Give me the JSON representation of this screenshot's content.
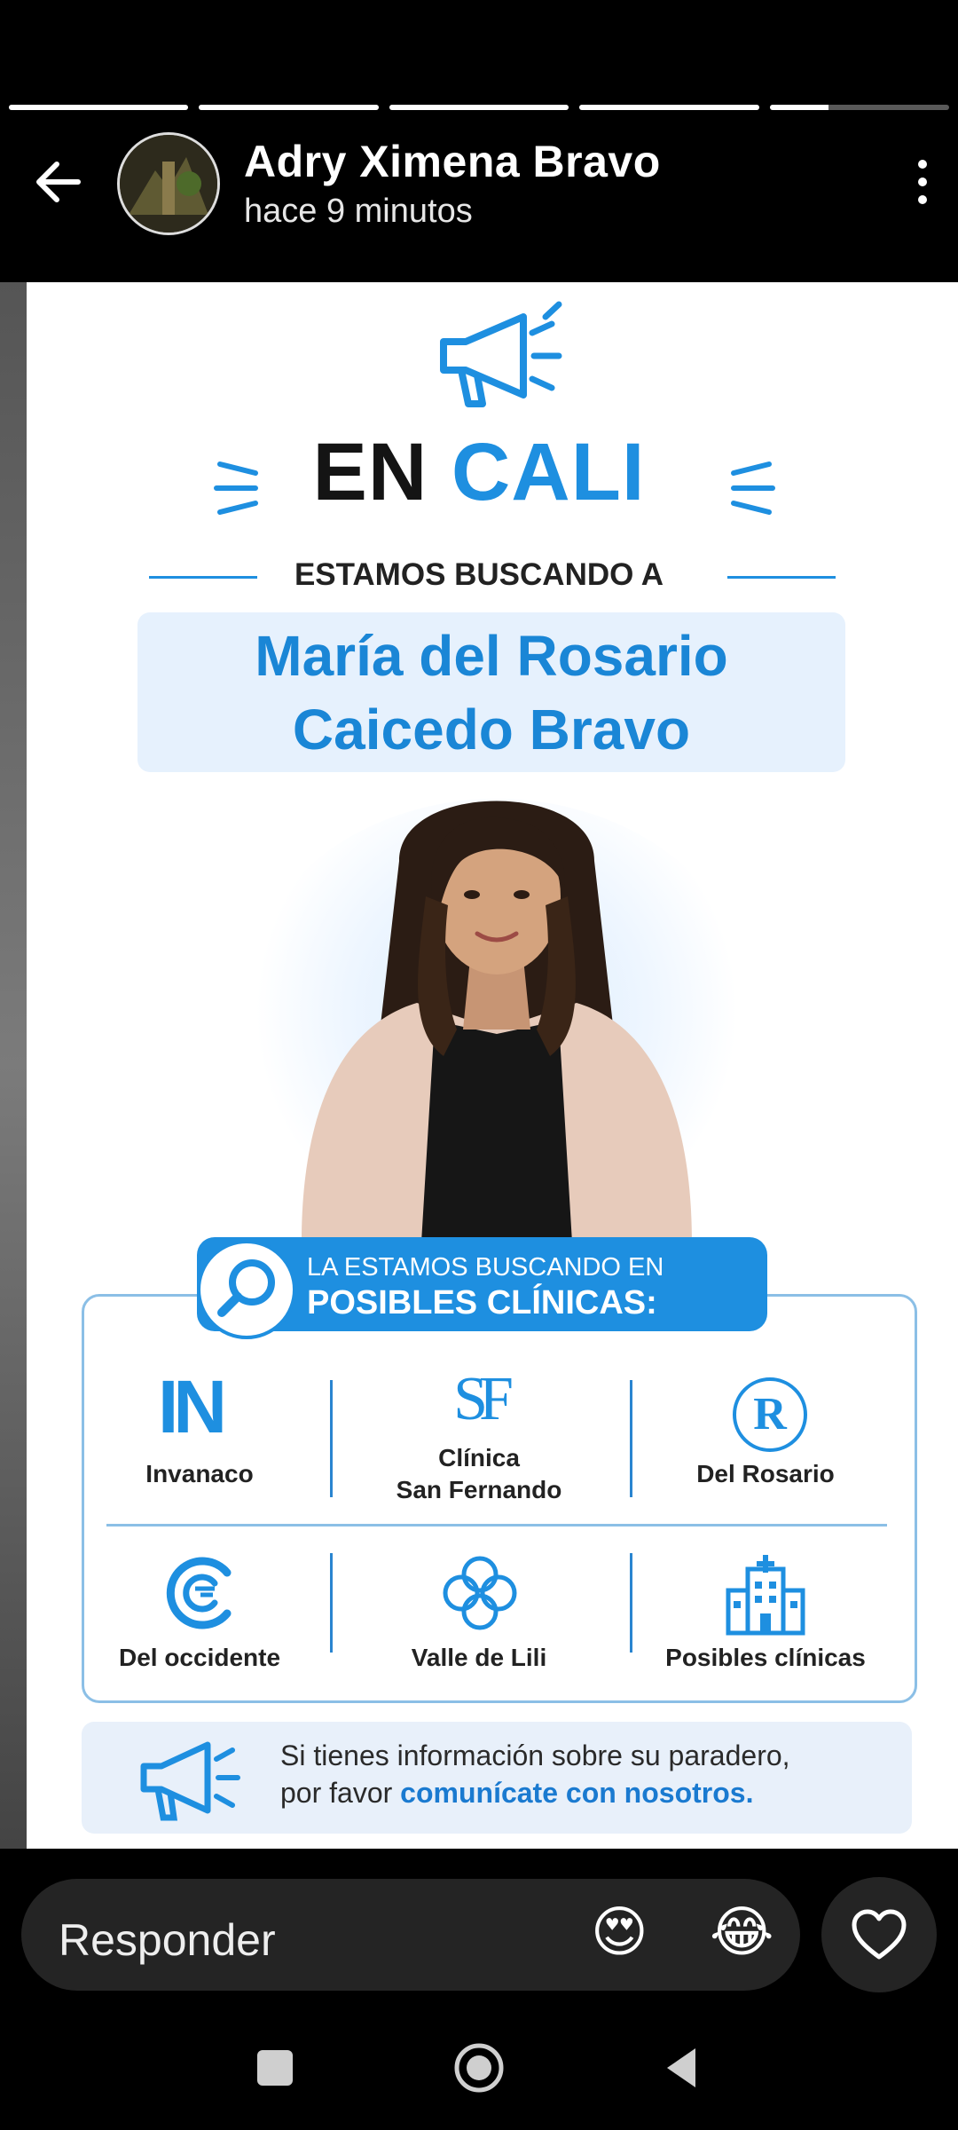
{
  "story_progress": {
    "segments": [
      1,
      1,
      1,
      1,
      0.33
    ]
  },
  "header": {
    "username": "Adry Ximena Bravo",
    "time_ago": "hace 9 minutos"
  },
  "poster": {
    "title_prefix": "EN",
    "title_city": "CALI",
    "subtitle": "ESTAMOS BUSCANDO A",
    "name_line1": "María del Rosario",
    "name_line2": "Caicedo Bravo",
    "search_line1": "LA ESTAMOS BUSCANDO EN",
    "search_line2": "POSIBLES CLÍNICAS:",
    "clinics": [
      {
        "logo_text": "IN",
        "label": "Invanaco",
        "label2": ""
      },
      {
        "logo_text": "SF",
        "label": "Clínica",
        "label2": "San Fernando"
      },
      {
        "logo_text": "R",
        "label": "Del Rosario",
        "label2": ""
      },
      {
        "logo_text": "",
        "label": "Del occidente",
        "label2": ""
      },
      {
        "logo_text": "",
        "label": "Valle de Lili",
        "label2": ""
      },
      {
        "logo_text": "",
        "label": "Posibles clínicas",
        "label2": ""
      }
    ],
    "footer_line1": "Si tienes información sobre su paradero,",
    "footer_line2_plain": "por favor",
    "footer_line2_bold": "comunícate con nosotros."
  },
  "reply_bar": {
    "placeholder": "Responder",
    "emoji_1": "😍",
    "emoji_2": "😂"
  },
  "colors": {
    "accent": "#1e8fe0",
    "dark": "#141414"
  }
}
